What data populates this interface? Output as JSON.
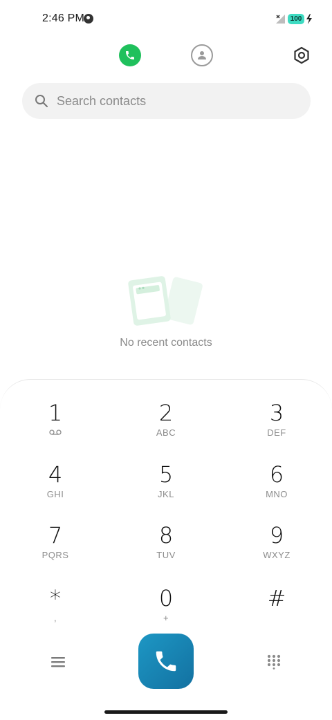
{
  "status_bar": {
    "time": "2:46 PM",
    "battery": "100"
  },
  "nav": {
    "calls_icon": "phone-icon",
    "contacts_icon": "person-icon",
    "settings_icon": "settings-icon",
    "active_color": "#1fc05c"
  },
  "search": {
    "placeholder": "Search contacts"
  },
  "empty_state": {
    "message": "No recent contacts"
  },
  "keypad": {
    "keys": [
      {
        "digit": "1",
        "letters": ""
      },
      {
        "digit": "2",
        "letters": "ABC"
      },
      {
        "digit": "3",
        "letters": "DEF"
      },
      {
        "digit": "4",
        "letters": "GHI"
      },
      {
        "digit": "5",
        "letters": "JKL"
      },
      {
        "digit": "6",
        "letters": "MNO"
      },
      {
        "digit": "7",
        "letters": "PQRS"
      },
      {
        "digit": "8",
        "letters": "TUV"
      },
      {
        "digit": "9",
        "letters": "WXYZ"
      },
      {
        "digit": "*",
        "letters": ","
      },
      {
        "digit": "0",
        "letters": "+"
      },
      {
        "digit": "#",
        "letters": ""
      }
    ]
  },
  "actions": {
    "call_color": "#1a86b6"
  }
}
